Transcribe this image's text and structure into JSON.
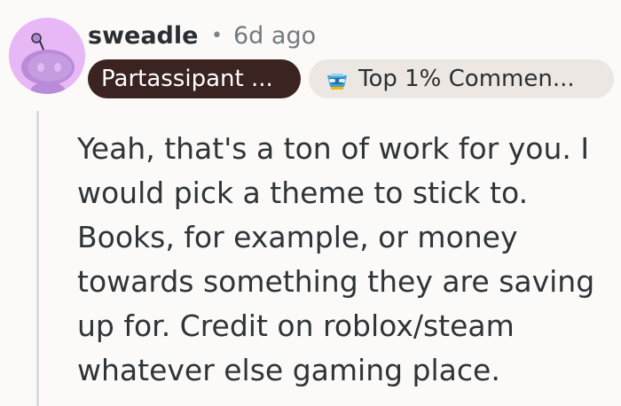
{
  "comment": {
    "username": "sweadle",
    "separator": "•",
    "timestamp": "6d ago",
    "flair_badge": "Partassipant ...",
    "top_badge": "Top 1% Commen...",
    "body": "Yeah, that's a ton of work for you. I\nwould pick a theme to stick to.\nBooks, for example, or money\ntowards something they are saving\nup for. Credit on roblox/steam\nwhatever else gaming place.",
    "icons": {
      "avatar": "reddit-snoo-avatar-icon",
      "top_badge": "trophy-icon"
    },
    "colors": {
      "avatar_bg": "#e7b7f6",
      "flair_bg": "#3a2320",
      "top_badge_bg": "#ece7e2",
      "thread_line": "#d9dde0"
    }
  }
}
